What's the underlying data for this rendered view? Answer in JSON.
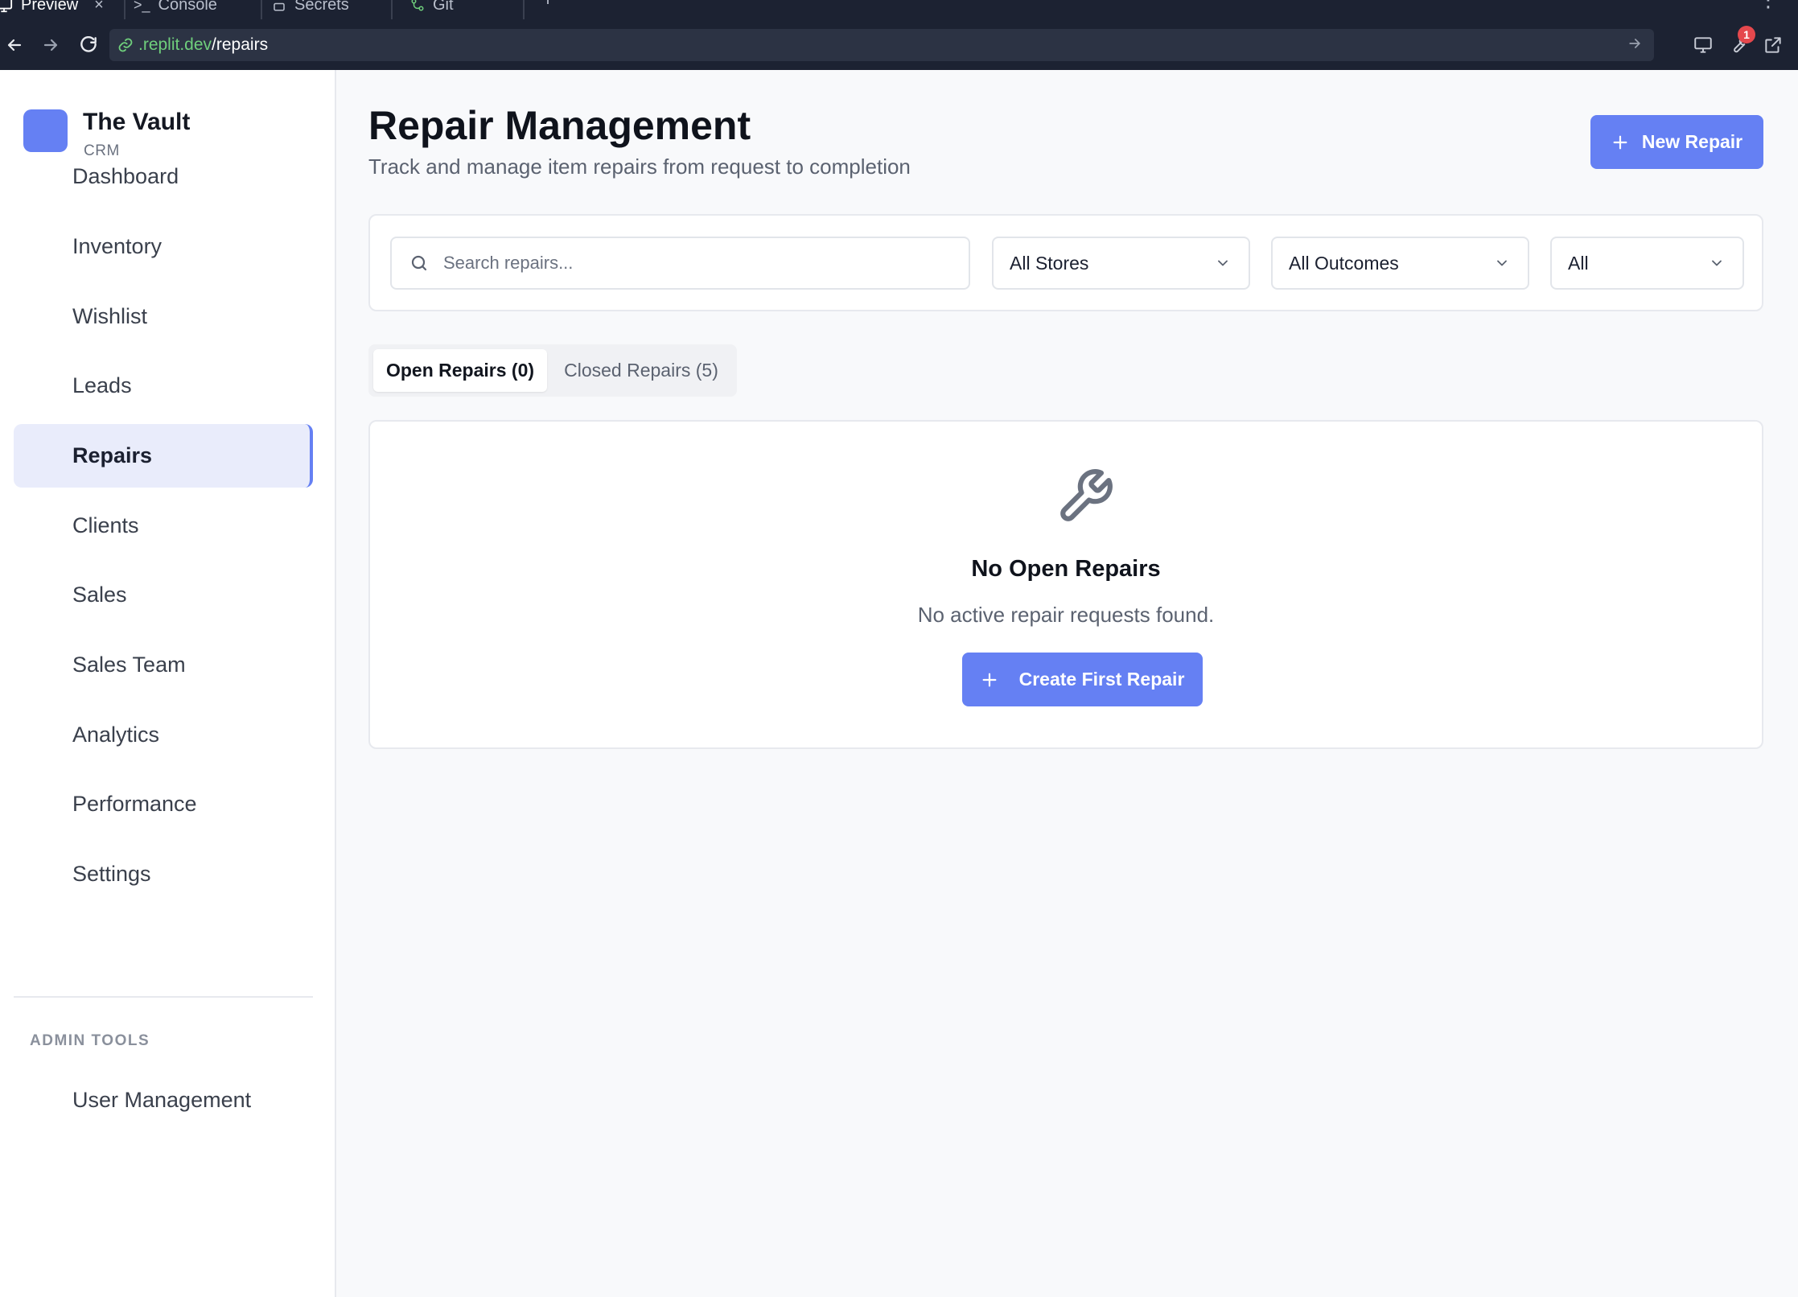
{
  "browser": {
    "tabs": [
      {
        "label": "Preview",
        "icon": "monitor-icon",
        "active": true
      },
      {
        "label": "Console",
        "icon": "terminal-icon"
      },
      {
        "label": "Secrets",
        "icon": "lock-icon"
      },
      {
        "label": "Git",
        "icon": "git-icon"
      }
    ],
    "close_glyph": "×",
    "plus_glyph": "+",
    "kebab_glyph": "⋮",
    "url_domain": ".replit.dev",
    "url_path": "/repairs",
    "notification_count": "1"
  },
  "sidebar": {
    "brand_name": "The Vault",
    "brand_sub": "CRM",
    "brand_color": "#6580f3",
    "items": [
      {
        "label": "Dashboard"
      },
      {
        "label": "Inventory"
      },
      {
        "label": "Wishlist"
      },
      {
        "label": "Leads"
      },
      {
        "label": "Repairs",
        "active": true
      },
      {
        "label": "Clients"
      },
      {
        "label": "Sales"
      },
      {
        "label": "Sales Team"
      },
      {
        "label": "Analytics"
      },
      {
        "label": "Performance"
      },
      {
        "label": "Settings"
      }
    ],
    "admin_heading": "ADMIN TOOLS",
    "admin_items": [
      {
        "label": "User Management"
      }
    ]
  },
  "page": {
    "title": "Repair Management",
    "subtitle": "Track and manage item repairs from request to completion",
    "new_button": "New Repair",
    "accent": "#6580f3"
  },
  "filters": {
    "search_placeholder": "Search repairs...",
    "store": "All Stores",
    "outcome": "All Outcomes",
    "type": "All"
  },
  "tabs": {
    "open": "Open Repairs (0)",
    "closed": "Closed Repairs (5)"
  },
  "empty_state": {
    "icon": "wrench-icon",
    "title": "No Open Repairs",
    "description": "No active repair requests found.",
    "button": "Create First Repair"
  }
}
